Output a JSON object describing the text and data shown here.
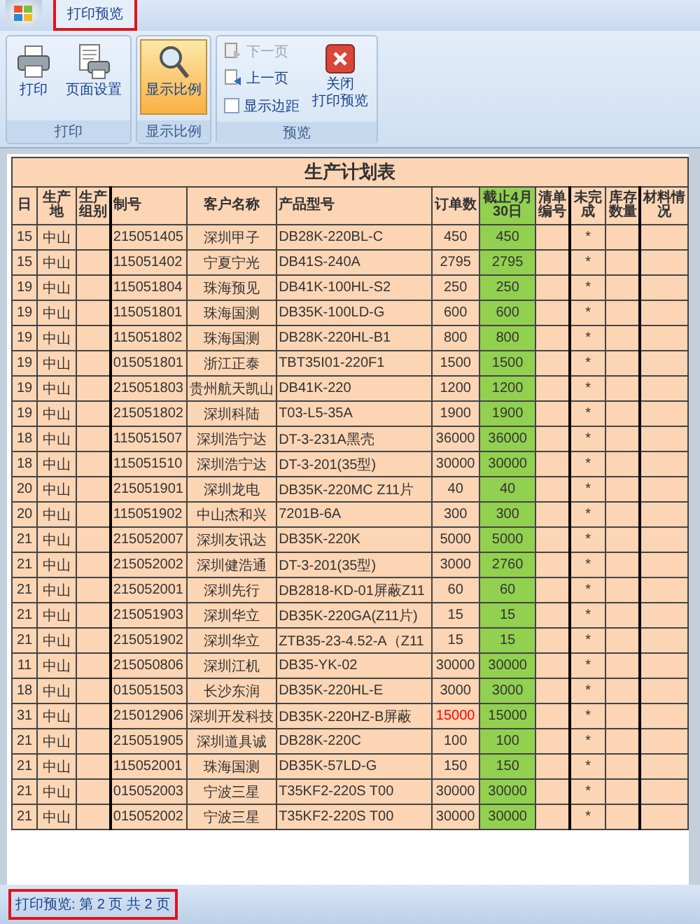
{
  "tabs": [
    "打印预览"
  ],
  "ribbon": {
    "groups": [
      {
        "label": "打印",
        "items": [
          {
            "kind": "large",
            "lines": [
              "打印"
            ],
            "selected": false
          },
          {
            "kind": "large",
            "lines": [
              "页面设置"
            ],
            "selected": false
          }
        ]
      },
      {
        "label": "显示比例",
        "items": [
          {
            "kind": "large",
            "lines": [
              "显示比例"
            ],
            "selected": true
          }
        ]
      },
      {
        "label": "预览",
        "items": [
          {
            "kind": "small",
            "label": "下一页",
            "disabled": true
          },
          {
            "kind": "small",
            "label": "上一页",
            "disabled": false
          },
          {
            "kind": "checkbox",
            "label": "显示边距",
            "checked": false
          },
          {
            "kind": "large",
            "lines": [
              "关闭",
              "打印预览"
            ],
            "selected": false
          }
        ]
      }
    ]
  },
  "sheet": {
    "title": "生产计划表",
    "columns": [
      "日",
      "生产地",
      "生产组别",
      "制号",
      "客户名称",
      "产品型号",
      "订单数",
      "截止4月30日",
      "清单编号",
      "未完成",
      "库存数量",
      "材料情况"
    ],
    "rows": [
      {
        "cells": [
          "15",
          "中山",
          "",
          "215051405",
          "深圳甲子",
          "DB28K-220BL-C",
          "450",
          "450",
          "",
          "*",
          "",
          ""
        ],
        "alert": false
      },
      {
        "cells": [
          "15",
          "中山",
          "",
          "115051402",
          "宁夏宁光",
          "DB41S-240A",
          "2795",
          "2795",
          "",
          "*",
          "",
          ""
        ],
        "alert": false
      },
      {
        "cells": [
          "19",
          "中山",
          "",
          "115051804",
          "珠海预见",
          "DB41K-100HL-S2",
          "250",
          "250",
          "",
          "*",
          "",
          ""
        ],
        "alert": false
      },
      {
        "cells": [
          "19",
          "中山",
          "",
          "115051801",
          "珠海国测",
          "DB35K-100LD-G",
          "600",
          "600",
          "",
          "*",
          "",
          ""
        ],
        "alert": false
      },
      {
        "cells": [
          "19",
          "中山",
          "",
          "115051802",
          "珠海国测",
          "DB28K-220HL-B1",
          "800",
          "800",
          "",
          "*",
          "",
          ""
        ],
        "alert": false
      },
      {
        "cells": [
          "19",
          "中山",
          "",
          "015051801",
          "浙江正泰",
          "TBT35I01-220F1",
          "1500",
          "1500",
          "",
          "*",
          "",
          ""
        ],
        "alert": false
      },
      {
        "cells": [
          "19",
          "中山",
          "",
          "215051803",
          "贵州航天凯山",
          "DB41K-220",
          "1200",
          "1200",
          "",
          "*",
          "",
          ""
        ],
        "alert": false
      },
      {
        "cells": [
          "19",
          "中山",
          "",
          "215051802",
          "深圳科陆",
          "T03-L5-35A",
          "1900",
          "1900",
          "",
          "*",
          "",
          ""
        ],
        "alert": false
      },
      {
        "cells": [
          "18",
          "中山",
          "",
          "115051507",
          "深圳浩宁达",
          "DT-3-231A黑壳",
          "36000",
          "36000",
          "",
          "*",
          "",
          ""
        ],
        "alert": false
      },
      {
        "cells": [
          "18",
          "中山",
          "",
          "115051510",
          "深圳浩宁达",
          "DT-3-201(35型)",
          "30000",
          "30000",
          "",
          "*",
          "",
          ""
        ],
        "alert": false
      },
      {
        "cells": [
          "20",
          "中山",
          "",
          "215051901",
          "深圳龙电",
          "DB35K-220MC  Z11片",
          "40",
          "40",
          "",
          "*",
          "",
          ""
        ],
        "alert": false
      },
      {
        "cells": [
          "20",
          "中山",
          "",
          "115051902",
          "中山杰和兴",
          "7201B-6A",
          "300",
          "300",
          "",
          "*",
          "",
          ""
        ],
        "alert": false
      },
      {
        "cells": [
          "21",
          "中山",
          "",
          "215052007",
          "深圳友讯达",
          "DB35K-220K",
          "5000",
          "5000",
          "",
          "*",
          "",
          ""
        ],
        "alert": false
      },
      {
        "cells": [
          "21",
          "中山",
          "",
          "215052002",
          "深圳健浩通",
          "DT-3-201(35型)",
          "3000",
          "2760",
          "",
          "*",
          "",
          ""
        ],
        "alert": false
      },
      {
        "cells": [
          "21",
          "中山",
          "",
          "215052001",
          "深圳先行",
          "DB2818-KD-01屏蔽Z11",
          "60",
          "60",
          "",
          "*",
          "",
          ""
        ],
        "alert": false
      },
      {
        "cells": [
          "21",
          "中山",
          "",
          "215051903",
          "深圳华立",
          "DB35K-220GA(Z11片)",
          "15",
          "15",
          "",
          "*",
          "",
          ""
        ],
        "alert": false
      },
      {
        "cells": [
          "21",
          "中山",
          "",
          "215051902",
          "深圳华立",
          "ZTB35-23-4.52-A（Z11",
          "15",
          "15",
          "",
          "*",
          "",
          ""
        ],
        "alert": false
      },
      {
        "cells": [
          "11",
          "中山",
          "",
          "215050806",
          "深圳江机",
          "DB35-YK-02",
          "30000",
          "30000",
          "",
          "*",
          "",
          ""
        ],
        "alert": false
      },
      {
        "cells": [
          "18",
          "中山",
          "",
          "015051503",
          "长沙东润",
          "DB35K-220HL-E",
          "3000",
          "3000",
          "",
          "*",
          "",
          ""
        ],
        "alert": false
      },
      {
        "cells": [
          "31",
          "中山",
          "",
          "215012906",
          "深圳开发科技",
          "DB35K-220HZ-B屏蔽",
          "15000",
          "15000",
          "",
          "*",
          "",
          ""
        ],
        "alert": true
      },
      {
        "cells": [
          "21",
          "中山",
          "",
          "215051905",
          "深圳道具诚",
          "DB28K-220C",
          "100",
          "100",
          "",
          "*",
          "",
          ""
        ],
        "alert": false
      },
      {
        "cells": [
          "21",
          "中山",
          "",
          "115052001",
          "珠海国测",
          "DB35K-57LD-G",
          "150",
          "150",
          "",
          "*",
          "",
          ""
        ],
        "alert": false
      },
      {
        "cells": [
          "21",
          "中山",
          "",
          "015052003",
          "宁波三星",
          "T35KF2-220S T00",
          "30000",
          "30000",
          "",
          "*",
          "",
          ""
        ],
        "alert": false
      },
      {
        "cells": [
          "21",
          "中山",
          "",
          "015052002",
          "宁波三星",
          "T35KF2-220S T00",
          "30000",
          "30000",
          "",
          "*",
          "",
          ""
        ],
        "alert": false
      }
    ]
  },
  "status_bar": "打印预览: 第 2 页 共 2 页"
}
